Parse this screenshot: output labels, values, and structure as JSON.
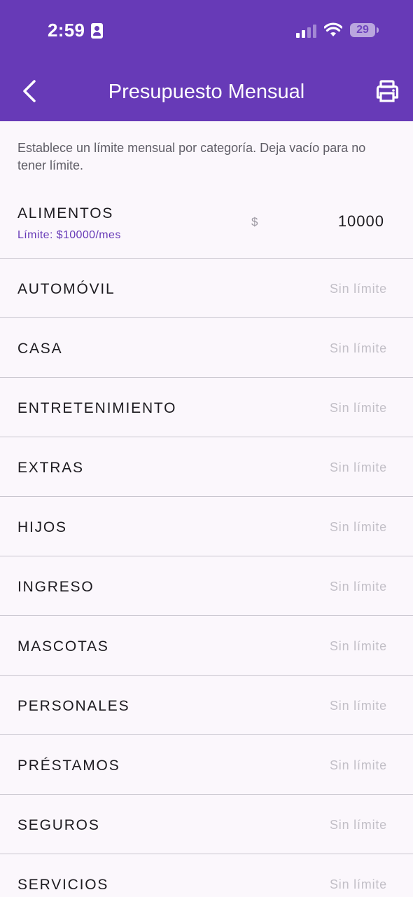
{
  "status_bar": {
    "time": "2:59",
    "battery": "29"
  },
  "header": {
    "title": "Presupuesto Mensual",
    "back_icon": "chevron-left-icon",
    "print_icon": "printer-icon",
    "background_color": "#673ab7"
  },
  "intro_text": "Establece un límite mensual por categoría. Deja vacío para no tener límite.",
  "categories": [
    {
      "name": "ALIMENTOS",
      "limit_label": "Límite: $10000/mes",
      "currency": "$",
      "value": "10000"
    },
    {
      "name": "AUTOMÓVIL",
      "placeholder": "Sin límite"
    },
    {
      "name": "CASA",
      "placeholder": "Sin límite"
    },
    {
      "name": "ENTRETENIMIENTO",
      "placeholder": "Sin límite"
    },
    {
      "name": "EXTRAS",
      "placeholder": "Sin límite"
    },
    {
      "name": "HIJOS",
      "placeholder": "Sin límite"
    },
    {
      "name": "INGRESO",
      "placeholder": "Sin límite"
    },
    {
      "name": "MASCOTAS",
      "placeholder": "Sin límite"
    },
    {
      "name": "PERSONALES",
      "placeholder": "Sin límite"
    },
    {
      "name": "PRÉSTAMOS",
      "placeholder": "Sin límite"
    },
    {
      "name": "SEGUROS",
      "placeholder": "Sin límite"
    },
    {
      "name": "SERVICIOS",
      "placeholder": "Sin límite"
    }
  ]
}
